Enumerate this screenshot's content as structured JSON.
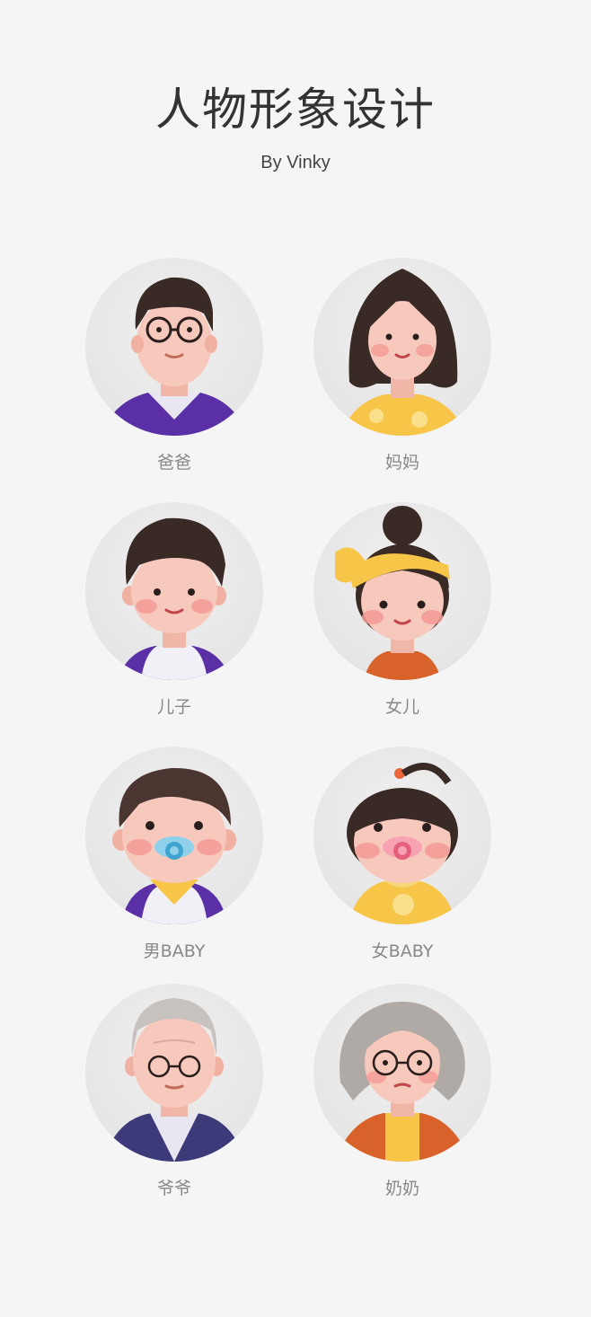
{
  "header": {
    "title": "人物形象设计",
    "subtitle": "By Vinky"
  },
  "avatars": [
    {
      "label": "爸爸",
      "icon": "father-avatar-icon"
    },
    {
      "label": "妈妈",
      "icon": "mother-avatar-icon"
    },
    {
      "label": "儿子",
      "icon": "son-avatar-icon"
    },
    {
      "label": "女儿",
      "icon": "daughter-avatar-icon"
    },
    {
      "label": "男BABY",
      "icon": "baby-boy-avatar-icon"
    },
    {
      "label": "女BABY",
      "icon": "baby-girl-avatar-icon"
    },
    {
      "label": "爷爷",
      "icon": "grandfather-avatar-icon"
    },
    {
      "label": "奶奶",
      "icon": "grandmother-avatar-icon"
    }
  ],
  "colors": {
    "background": "#f5f5f5",
    "avatar_circle": "#e8e8e8",
    "skin": "#f7c9bd",
    "cheek": "#f49a95",
    "hair_dark": "#3a2a26",
    "hair_gray": "#b0aaa6",
    "purple": "#5b2fa5",
    "yellow": "#f7c548",
    "orange": "#d9622a"
  }
}
